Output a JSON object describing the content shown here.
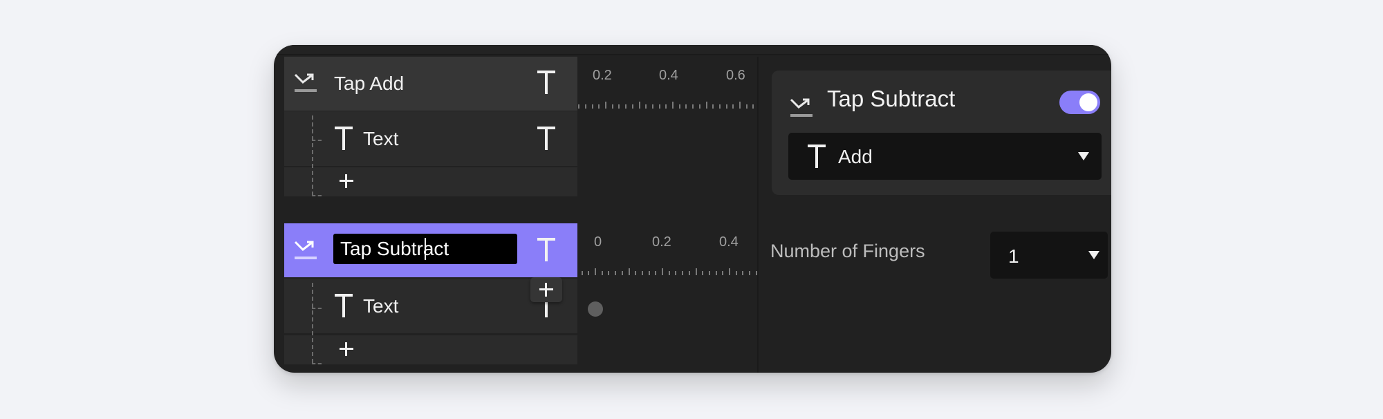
{
  "layers": [
    {
      "name": "Tap Add",
      "type_icon": "gesture-tap-icon",
      "trailing_icon": "text-type-icon",
      "children": [
        {
          "label": "Text",
          "icon": "text-type-icon",
          "trailing_icon": "text-type-icon"
        }
      ],
      "add_label": "+"
    },
    {
      "name": "Tap Subtract",
      "selected": true,
      "editing": true,
      "input_value": "Tap Subtract",
      "type_icon": "gesture-tap-icon",
      "trailing_icon": "text-type-icon",
      "children": [
        {
          "label": "Text",
          "icon": "text-type-icon",
          "trailing_icon": "text-type-icon"
        }
      ],
      "add_label": "+"
    }
  ],
  "add_tooltip_label": "+",
  "timelines": [
    {
      "tick_labels": [
        "0.2",
        "0.4",
        "0.6"
      ],
      "visible_start": 0.0,
      "step": 0.1
    },
    {
      "tick_labels": [
        "0",
        "0.2",
        "0.4"
      ],
      "visible_start": 0.0,
      "step": 0.1,
      "keyframe_at": 0
    }
  ],
  "inspector": {
    "title": "Tap Subtract",
    "title_icon": "gesture-tap-icon",
    "enabled": true,
    "action_dropdown": {
      "icon": "text-type-icon",
      "value": "Add"
    },
    "fields": [
      {
        "label": "Number of Fingers",
        "value": "1"
      }
    ]
  },
  "colors": {
    "accent": "#8a7ef9",
    "panel_bg": "#212121",
    "header_row": "#363636",
    "child_row": "#2b2b2b",
    "page_bg": "#f2f3f7"
  }
}
